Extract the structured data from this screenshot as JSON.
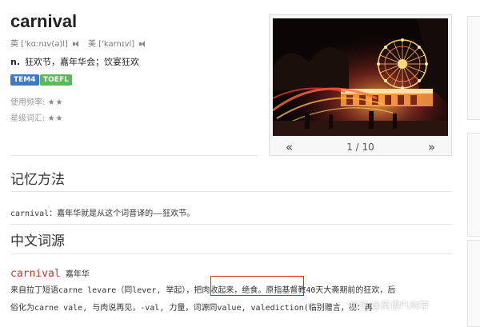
{
  "entry": {
    "word": "carnival",
    "uk_label": "英",
    "uk_phonetic": "['kɑːnɪv(ə)l]",
    "us_label": "美",
    "us_phonetic": "['karnɪvl]",
    "pos": "n.",
    "definition": "狂欢节，嘉年华会；饮宴狂欢",
    "tags": [
      "TEM4",
      "TOEFL"
    ],
    "frequency_label": "使用频率:",
    "frequency_stars": "★★",
    "star_label": "星级词汇:",
    "star_stars": "★★"
  },
  "gallery": {
    "prev": "«",
    "next": "»",
    "counter": "1 / 10"
  },
  "memory": {
    "heading": "记忆方法",
    "text": "carnival：嘉年华就是从这个词音译的——狂欢节。"
  },
  "etymology": {
    "heading": "中文词源",
    "word": "carnival",
    "gloss": "嘉年华",
    "line1_a": "来自拉丁短语carne levare（同lever, 举起），",
    "line1_b": "把肉收起来，绝食。",
    "line1_c": "原指基督教40天大斋期前的狂欢，后",
    "line2": "俗化为carne vale, 与肉说再见，-val, 力量，词源同value, valediction(临别赠言，视：再",
    "watermark": "知乎 @英语FUN学"
  },
  "colors": {
    "tag_tem4": "#3a7bc8",
    "tag_toefl": "#5cb85c",
    "etymology_word": "#c0392b",
    "highlight_box": "#dd2222"
  },
  "icons": [
    "speaker-icon",
    "prev-arrow-icon",
    "next-arrow-icon"
  ]
}
